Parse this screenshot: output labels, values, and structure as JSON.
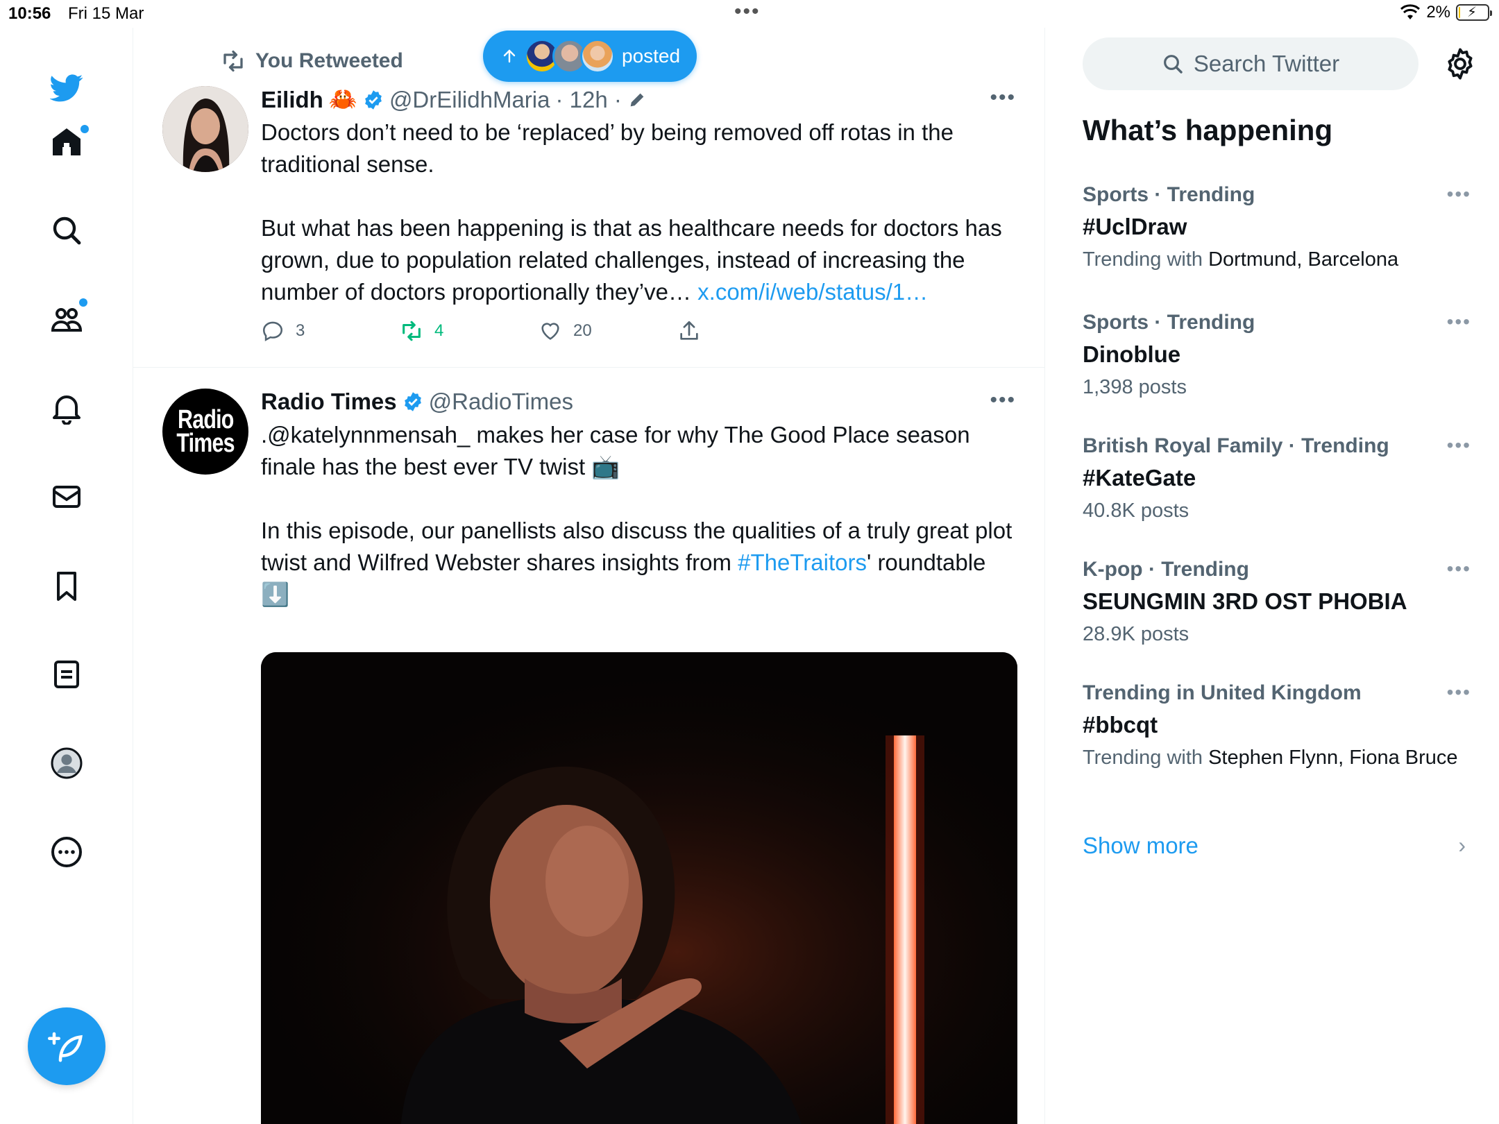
{
  "status_bar": {
    "time": "10:56",
    "date": "Fri 15 Mar",
    "battery": "2%",
    "battery_level": 0.02
  },
  "nav": {
    "items": [
      "home",
      "explore",
      "communities",
      "notifications",
      "messages",
      "bookmarks",
      "lists",
      "profile",
      "more"
    ],
    "accent_color": "#1d9bf0"
  },
  "new_posts_pill": {
    "label": "posted"
  },
  "tweets": [
    {
      "context": "You Retweeted",
      "name": "Eilidh",
      "emoji": "🦀",
      "handle": "@DrEilidhMaria",
      "time": "· 12h ·",
      "text_p1": "Doctors don’t need to be ‘replaced’ by being removed off rotas in the traditional sense.",
      "text_p2": "But what has been happening is that as healthcare needs for doctors has grown, due to population related challenges, instead of increasing the number of doctors proportionally they’ve…",
      "link": "x.com/i/web/status/1…",
      "replies": "3",
      "retweets": "4",
      "likes": "20"
    },
    {
      "name": "Radio Times",
      "handle": "@RadioTimes",
      "avatar_text_1": "Radio",
      "avatar_text_2": "Times",
      "text_p1": ".@katelynnmensah_ makes her case for why The Good Place season finale has the best ever TV twist 📺",
      "text_p2a": "In this episode, our panellists also discuss the qualities of a truly great plot twist and Wilfred Webster shares insights from ",
      "hashtag": "#TheTraitors",
      "text_p2b": "' roundtable ⬇️"
    }
  ],
  "sidebar": {
    "search_placeholder": "Search Twitter",
    "title": "What’s happening",
    "trends": [
      {
        "meta": "Sports · Trending",
        "name": "#UclDraw",
        "sub_prefix": "Trending with ",
        "sub": "Dortmund, Barcelona"
      },
      {
        "meta": "Sports · Trending",
        "name": "Dinoblue",
        "sub_prefix": "",
        "sub": "1,398 posts"
      },
      {
        "meta": "British Royal Family · Trending",
        "name": "#KateGate",
        "sub_prefix": "",
        "sub": "40.8K posts"
      },
      {
        "meta": "K-pop · Trending",
        "name": "SEUNGMIN 3RD OST PHOBIA",
        "sub_prefix": "",
        "sub": "28.9K posts"
      },
      {
        "meta": "Trending in United Kingdom",
        "name": "#bbcqt",
        "sub_prefix": "Trending with ",
        "sub": "Stephen Flynn, Fiona Bruce"
      }
    ],
    "show_more": "Show more"
  }
}
